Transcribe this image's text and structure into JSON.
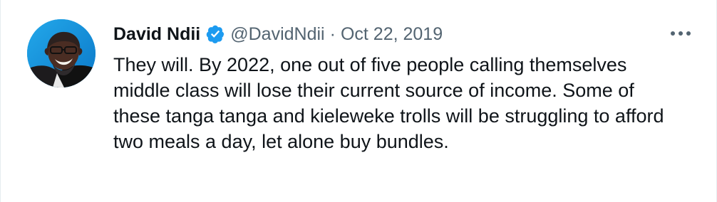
{
  "tweet": {
    "author": {
      "display_name": "David Ndii",
      "handle": "@DavidNdii",
      "verified_icon": "verified-badge-icon",
      "avatar": "profile-photo"
    },
    "separator": "·",
    "timestamp": "Oct 22, 2019",
    "more_icon": "more-options-icon",
    "text": "They will.  By 2022, one out of five people calling themselves middle class will lose their current source of income.  Some of these tanga tanga and kieleweke trolls will be struggling to afford two meals a day, let alone buy bundles."
  },
  "colors": {
    "verified": "#1d9bf0",
    "secondary_text": "#536471",
    "primary_text": "#0f1419",
    "avatar_background": "#1fa3e6"
  }
}
